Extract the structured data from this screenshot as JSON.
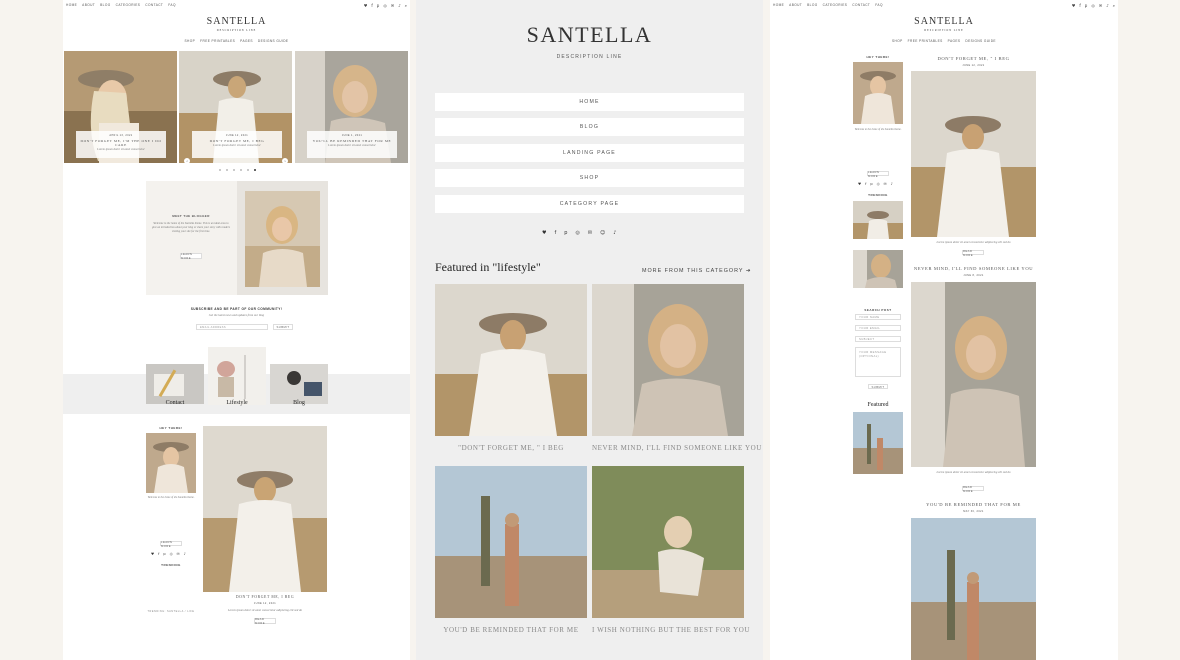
{
  "site": {
    "name": "SANTELLA",
    "tagline": "DESCRIPTION LINE"
  },
  "top_nav": [
    "HOME",
    "ABOUT",
    "BLOG",
    "CATEGORIES",
    "CONTACT",
    "FAQ"
  ],
  "main_nav": [
    "SHOP",
    "FREE PRINTABLES",
    "PAGES",
    "DESIGNS GUIDE"
  ],
  "slider": {
    "slides": [
      {
        "date": "APRIL 13, 2021",
        "title": "DON'T FORGET ME, I'M THE ONE I DO CARE",
        "excerpt": "Lorem ipsum dolor sit amet consectetur"
      },
      {
        "date": "JUNE 12, 2021",
        "title": "DON'T FORGET ME, I BEG",
        "excerpt": "Lorem ipsum dolor sit amet consectetur"
      },
      {
        "date": "JUNE 1, 2021",
        "title": "YOU'LL BE REMINDED THAT FOR ME",
        "excerpt": "Lorem ipsum dolor sit amet consectetur"
      }
    ],
    "dots": 6
  },
  "about": {
    "heading": "MEET THE BLOGGER",
    "text": "Welcome to the home of the Santella theme. This is an ideal area to give an introduction about your blog or share your story with readers visiting your site for the first time.",
    "button": "LEARN MORE"
  },
  "newsletter": {
    "heading": "SUBSCRIBE AND BE PART OF OUR COMMUNITY!",
    "sub": "Get the latest news and updates from our blog",
    "placeholder": "EMAIL ADDRESS",
    "button": "SUBMIT"
  },
  "categories": [
    "Contact",
    "Lifestyle",
    "Blog"
  ],
  "p1_sidebar": {
    "heading": "HEY THERE!",
    "text": "Welcome to the home of the Santella theme.",
    "button": "LEARN MORE",
    "trending": "TRENDING",
    "tags": "TRENDING: SANTELLA / LIFE"
  },
  "p1_post": {
    "title": "DON'T FORGET ME, I BEG",
    "date": "JUNE 12, 2021",
    "excerpt": "Lorem ipsum dolor sit amet consectetur adipiscing elit sed do",
    "button": "READ MORE"
  },
  "mobile_menu": [
    "HOME",
    "BLOG",
    "LANDING PAGE",
    "SHOP",
    "CATEGORY PAGE"
  ],
  "social_icons": [
    "twitter-icon",
    "facebook-icon",
    "pinterest-icon",
    "instagram-icon",
    "email-icon",
    "snapchat-icon",
    "tiktok-icon"
  ],
  "featured": {
    "heading": "Featured in \"lifestyle\"",
    "more_link": "MORE FROM THIS CATEGORY",
    "posts": [
      {
        "caption": "\"DON'T FORGET ME, \" I BEG"
      },
      {
        "caption": "NEVER MIND, I'LL FIND SOMEONE LIKE YOU"
      },
      {
        "caption": "YOU'D BE REMINDED THAT FOR ME"
      },
      {
        "caption": "I WISH NOTHING BUT THE BEST FOR YOU"
      }
    ]
  },
  "p3_posts": [
    {
      "title": "DON'T FORGET ME, \" I BEG",
      "date": "JUNE 12, 2021",
      "button": "READ MORE"
    },
    {
      "title": "NEVER MIND, I'LL FIND SOMEONE LIKE YOU",
      "date": "JUNE 8, 2021",
      "button": "READ MORE"
    },
    {
      "title": "YOU'D BE REMINDED THAT FOR ME",
      "date": "MAY 30, 2021"
    }
  ],
  "p3_sidebar": {
    "heading": "HEY THERE!",
    "button": "LEARN MORE",
    "trending": "TRENDING",
    "search": "SEARCH POST",
    "fields": [
      "YOUR NAME",
      "YOUR EMAIL",
      "SUBJECT",
      "YOUR MESSAGE (OPTIONAL)"
    ],
    "submit": "SUBMIT",
    "featured": "Featured"
  },
  "colors": {
    "bg": "#f7f4ef",
    "panel_grey": "#efefef",
    "text": "#333333"
  }
}
